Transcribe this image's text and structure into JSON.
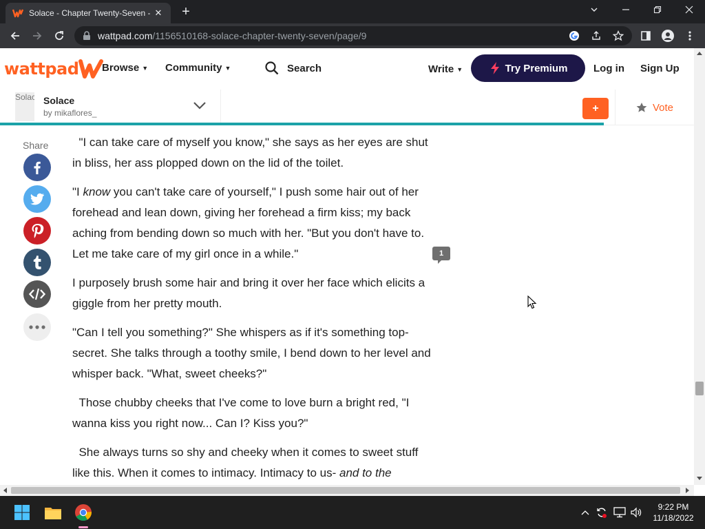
{
  "browser": {
    "tab_title": "Solace - Chapter Twenty-Seven -",
    "tab_close": "✕",
    "new_tab": "+",
    "url_host": "wattpad.com",
    "url_path": "/1156510168-solace-chapter-twenty-seven/page/9"
  },
  "header": {
    "logo_text": "wattpad",
    "browse": "Browse",
    "community": "Community",
    "search": "Search",
    "write": "Write",
    "premium": "Try Premium",
    "login": "Log in",
    "signup": "Sign Up"
  },
  "story_bar": {
    "cover_alt": "Solace",
    "title": "Solace",
    "author": "by mikaflores_",
    "add_label": "+",
    "vote": "Vote",
    "progress_fraction": 0.87
  },
  "share": {
    "label": "Share",
    "buttons": [
      {
        "name": "facebook",
        "color": "#3b5998"
      },
      {
        "name": "twitter",
        "color": "#55acee"
      },
      {
        "name": "pinterest",
        "color": "#cb2027"
      },
      {
        "name": "tumblr",
        "color": "#34526f"
      },
      {
        "name": "embed",
        "color": "#555555"
      },
      {
        "name": "more",
        "color": "#eeeeee"
      }
    ]
  },
  "story": {
    "p1": "  \"I can take care of myself you know,\" she says as her eyes are shut in bliss, her ass plopped down on the lid of the toilet.",
    "p2_a": "\"I ",
    "p2_em": "know",
    "p2_b": " you can't take care of yourself,\" I push some hair out of her forehead and lean down, giving her forehead a firm kiss; my back aching from bending down so much with her. \"But you don't have to. Let me take care of my girl once in a while.\"",
    "p3": "I purposely brush some hair and bring it over her face which elicits a giggle from her pretty mouth.",
    "p4": "\"Can I tell you something?\" She whispers as if it's something top-secret. She talks through a toothy smile, I bend down to her level and whisper back. \"What, sweet cheeks?\"",
    "p5": "  Those chubby cheeks that I've come to love burn a bright red, \"I wanna kiss you right now... Can I? Kiss you?\"",
    "p6_a": "  She always turns so shy and cheeky when it comes to sweet stuff like this. When it comes to intimacy. Intimacy to us- ",
    "p6_em": "and to the",
    "comment_count": "1"
  },
  "taskbar": {
    "time": "9:22 PM",
    "date": "11/18/2022"
  },
  "colors": {
    "brand": "#ff6122",
    "premium_bg": "#1d1748",
    "progress": "#1ba2a8"
  }
}
